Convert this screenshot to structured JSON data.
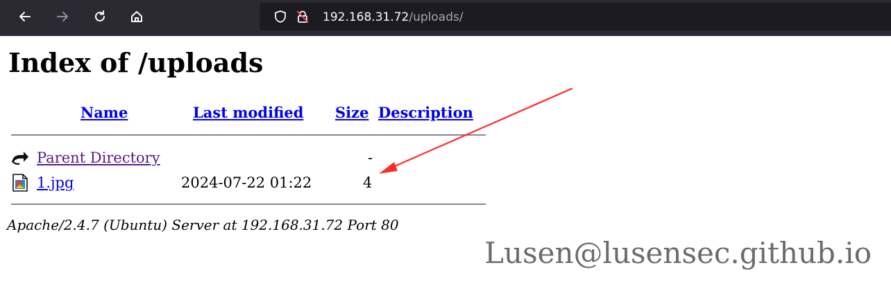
{
  "browser": {
    "url_host": "192.168.31.72",
    "url_path": "/uploads/",
    "icons": {
      "back": "back-arrow-icon",
      "forward": "forward-arrow-icon",
      "reload": "reload-icon",
      "home": "home-icon",
      "shield": "tracking-protection-shield-icon",
      "insecure": "insecure-lock-icon"
    }
  },
  "page": {
    "title": "Index of /uploads",
    "columns": {
      "name": "Name",
      "last_modified": "Last modified",
      "size": "Size",
      "description": "Description"
    },
    "rows": [
      {
        "icon": "back-folder-icon",
        "name": "Parent Directory",
        "modified": "",
        "size": "-",
        "description": ""
      },
      {
        "icon": "image-file-icon",
        "name": "1.jpg",
        "modified": "2024-07-22 01:22",
        "size": "4",
        "description": ""
      }
    ],
    "footer": "Apache/2.4.7 (Ubuntu) Server at 192.168.31.72 Port 80"
  },
  "annotation": {
    "arrow_color": "#ff2a2a"
  },
  "watermark": {
    "text": "Lusen@lusensec.github.io"
  },
  "colors": {
    "toolbar_bg": "#2b2a33",
    "urlbar_bg": "#1c1b22",
    "link": "#0000ee",
    "visited_link": "#551a8b"
  }
}
